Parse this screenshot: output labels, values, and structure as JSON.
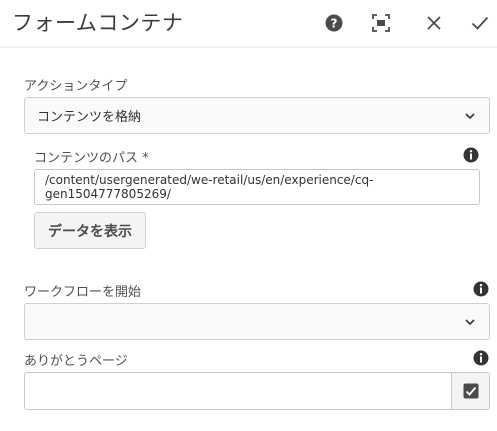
{
  "header": {
    "title": "フォームコンテナ"
  },
  "form": {
    "action_type": {
      "label": "アクションタイプ",
      "value": "コンテンツを格納"
    },
    "content_path": {
      "label": "コンテンツのパス *",
      "value": "/content/usergenerated/we-retail/us/en/experience/cq-gen1504777805269/"
    },
    "view_data_button": "データを表示",
    "workflow": {
      "label": "ワークフローを開始",
      "value": ""
    },
    "thank_you_page": {
      "label": "ありがとうページ",
      "value": ""
    }
  },
  "icons": {
    "help": "help-icon",
    "fullscreen": "fullscreen-icon",
    "close": "close-icon",
    "done": "checkmark-icon",
    "info": "info-icon",
    "chevron": "chevron-down-icon",
    "picker": "checkbox-picker-icon"
  },
  "colors": {
    "icon_dark": "#4b4b4b",
    "field_border": "#d0d0d0",
    "header_border": "#f0f0f0"
  }
}
